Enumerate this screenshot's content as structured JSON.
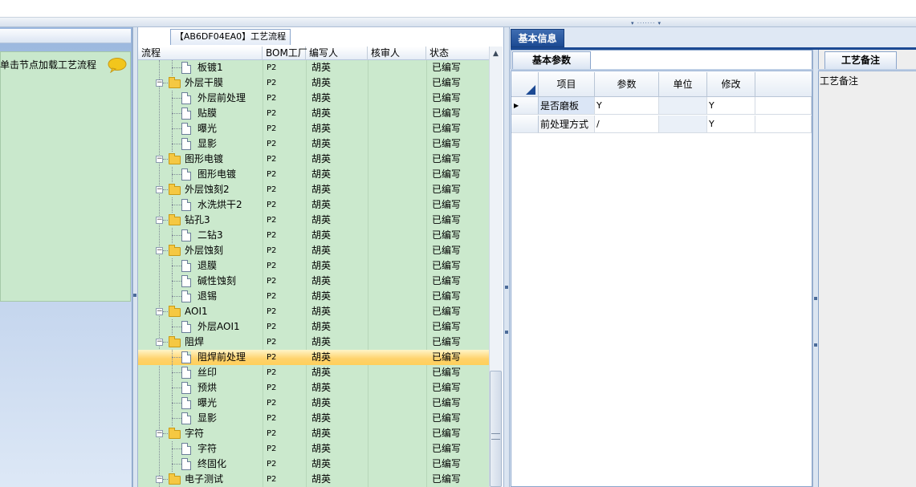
{
  "left_panel": {
    "hint": "单击节点加载工艺流程"
  },
  "tree_panel": {
    "tab_label": "【AB6DF04EA0】工艺流程",
    "columns": [
      "流程",
      "BOM工厂",
      "编写人",
      "核审人",
      "状态"
    ],
    "rows": [
      {
        "name": "板镀1",
        "type": "leaf",
        "factory": "P2",
        "writer": "胡英",
        "reviewer": "",
        "status": "已编写"
      },
      {
        "name": "外层干膜",
        "type": "folder",
        "factory": "P2",
        "writer": "胡英",
        "reviewer": "",
        "status": "已编写"
      },
      {
        "name": "外层前处理",
        "type": "leaf",
        "factory": "P2",
        "writer": "胡英",
        "reviewer": "",
        "status": "已编写"
      },
      {
        "name": "贴膜",
        "type": "leaf",
        "factory": "P2",
        "writer": "胡英",
        "reviewer": "",
        "status": "已编写"
      },
      {
        "name": "曝光",
        "type": "leaf",
        "factory": "P2",
        "writer": "胡英",
        "reviewer": "",
        "status": "已编写"
      },
      {
        "name": "显影",
        "type": "leaf",
        "factory": "P2",
        "writer": "胡英",
        "reviewer": "",
        "status": "已编写"
      },
      {
        "name": "图形电镀",
        "type": "folder",
        "factory": "P2",
        "writer": "胡英",
        "reviewer": "",
        "status": "已编写"
      },
      {
        "name": "图形电镀",
        "type": "leaf",
        "factory": "P2",
        "writer": "胡英",
        "reviewer": "",
        "status": "已编写"
      },
      {
        "name": "外层蚀刻2",
        "type": "folder",
        "factory": "P2",
        "writer": "胡英",
        "reviewer": "",
        "status": "已编写"
      },
      {
        "name": "水洗烘干2",
        "type": "leaf",
        "factory": "P2",
        "writer": "胡英",
        "reviewer": "",
        "status": "已编写"
      },
      {
        "name": "钻孔3",
        "type": "folder",
        "factory": "P2",
        "writer": "胡英",
        "reviewer": "",
        "status": "已编写"
      },
      {
        "name": "二钻3",
        "type": "leaf",
        "factory": "P2",
        "writer": "胡英",
        "reviewer": "",
        "status": "已编写"
      },
      {
        "name": "外层蚀刻",
        "type": "folder",
        "factory": "P2",
        "writer": "胡英",
        "reviewer": "",
        "status": "已编写"
      },
      {
        "name": "退膜",
        "type": "leaf",
        "factory": "P2",
        "writer": "胡英",
        "reviewer": "",
        "status": "已编写"
      },
      {
        "name": "碱性蚀刻",
        "type": "leaf",
        "factory": "P2",
        "writer": "胡英",
        "reviewer": "",
        "status": "已编写"
      },
      {
        "name": "退锡",
        "type": "leaf",
        "factory": "P2",
        "writer": "胡英",
        "reviewer": "",
        "status": "已编写"
      },
      {
        "name": "AOI1",
        "type": "folder",
        "factory": "P2",
        "writer": "胡英",
        "reviewer": "",
        "status": "已编写"
      },
      {
        "name": "外层AOI1",
        "type": "leaf",
        "factory": "P2",
        "writer": "胡英",
        "reviewer": "",
        "status": "已编写"
      },
      {
        "name": "阻焊",
        "type": "folder",
        "factory": "P2",
        "writer": "胡英",
        "reviewer": "",
        "status": "已编写"
      },
      {
        "name": "阻焊前处理",
        "type": "leaf",
        "factory": "P2",
        "writer": "胡英",
        "reviewer": "",
        "status": "已编写",
        "selected": true
      },
      {
        "name": "丝印",
        "type": "leaf",
        "factory": "P2",
        "writer": "胡英",
        "reviewer": "",
        "status": "已编写"
      },
      {
        "name": "预烘",
        "type": "leaf",
        "factory": "P2",
        "writer": "胡英",
        "reviewer": "",
        "status": "已编写"
      },
      {
        "name": "曝光",
        "type": "leaf",
        "factory": "P2",
        "writer": "胡英",
        "reviewer": "",
        "status": "已编写"
      },
      {
        "name": "显影",
        "type": "leaf",
        "factory": "P2",
        "writer": "胡英",
        "reviewer": "",
        "status": "已编写"
      },
      {
        "name": "字符",
        "type": "folder",
        "factory": "P2",
        "writer": "胡英",
        "reviewer": "",
        "status": "已编写"
      },
      {
        "name": "字符",
        "type": "leaf",
        "factory": "P2",
        "writer": "胡英",
        "reviewer": "",
        "status": "已编写"
      },
      {
        "name": "终固化",
        "type": "leaf",
        "factory": "P2",
        "writer": "胡英",
        "reviewer": "",
        "status": "已编写"
      },
      {
        "name": "电子测试",
        "type": "folder",
        "factory": "P2",
        "writer": "胡英",
        "reviewer": "",
        "status": "已编写"
      }
    ]
  },
  "right_panel": {
    "main_tab": "基本信息",
    "basic_tab": "基本参数",
    "grid_columns": [
      "项目",
      "参数",
      "单位",
      "修改"
    ],
    "grid_rows": [
      {
        "item": "是否磨板",
        "param": "Y",
        "unit": "",
        "modify": "Y",
        "current": true
      },
      {
        "item": "前处理方式",
        "param": "/",
        "unit": "",
        "modify": "Y",
        "current": false
      }
    ],
    "notes_tab": "工艺备注",
    "notes_label": "工艺备注"
  }
}
